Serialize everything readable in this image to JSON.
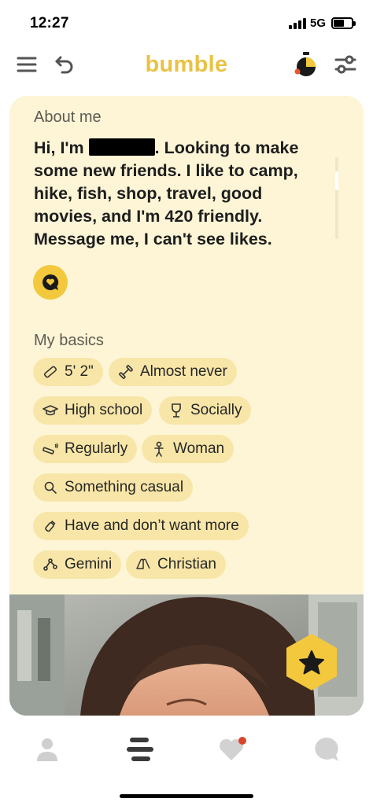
{
  "status_bar": {
    "time": "12:27",
    "network": "5G",
    "battery_level": 0.6
  },
  "header": {
    "brand": "bumble",
    "brand_color": "#e9c245",
    "icons": [
      "menu-icon",
      "back-icon",
      "snooze-icon",
      "filter-icon"
    ]
  },
  "profile": {
    "about_title": "About me",
    "about_before": "Hi, I'm ",
    "about_after": ". Looking to make some new friends. I like to camp, hike, fish, shop, travel, good movies, and I'm 420 friendly. Message me, I can't see likes.",
    "basics_title": "My basics",
    "basics": [
      {
        "icon": "ruler-icon",
        "label": "5' 2\""
      },
      {
        "icon": "dumbbell-icon",
        "label": "Almost never"
      },
      {
        "icon": "graduation-cap-icon",
        "label": "High school"
      },
      {
        "icon": "wine-glass-icon",
        "label": "Socially"
      },
      {
        "icon": "cigarette-icon",
        "label": "Regularly"
      },
      {
        "icon": "person-icon",
        "label": "Woman"
      },
      {
        "icon": "magnifier-icon",
        "label": "Something casual"
      },
      {
        "icon": "bottle-icon",
        "label": "Have and don’t want more"
      },
      {
        "icon": "zodiac-icon",
        "label": "Gemini"
      },
      {
        "icon": "praying-hands-icon",
        "label": "Christian"
      }
    ]
  },
  "colors": {
    "card_background": "#fdf5d6",
    "pill_background": "#f8e6a8",
    "accent_yellow": "#f3c83c",
    "notification_dot": "#d9442b"
  },
  "bottom_nav": {
    "items": [
      "profile-icon",
      "discover-icon",
      "liked-you-icon",
      "chats-icon"
    ],
    "active": "discover-icon",
    "liked_you_has_notification": true
  }
}
